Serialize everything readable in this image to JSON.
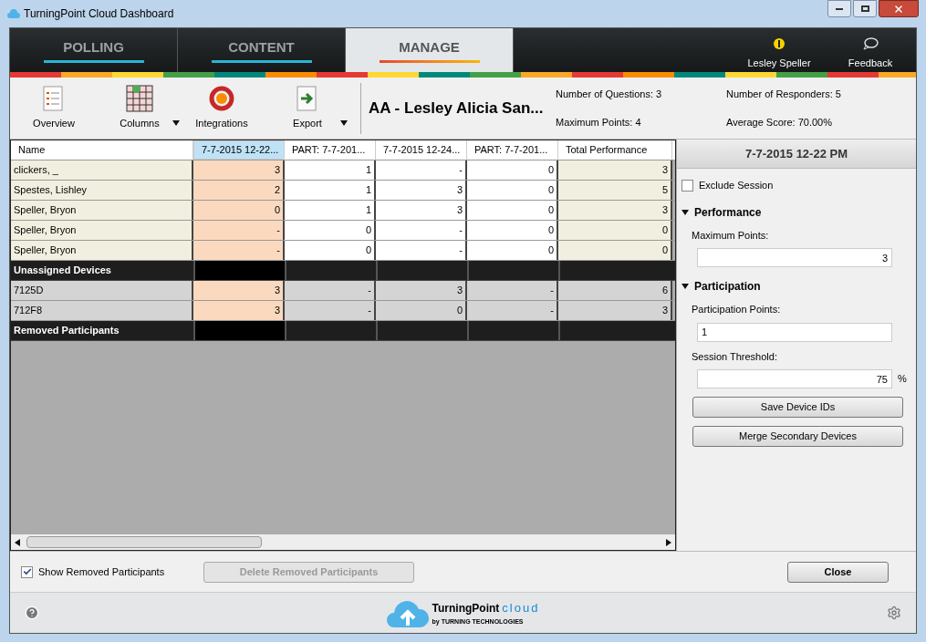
{
  "window": {
    "title": "TurningPoint Cloud Dashboard"
  },
  "nav_tabs": [
    {
      "label": "POLLING",
      "selected": false
    },
    {
      "label": "CONTENT",
      "selected": false
    },
    {
      "label": "MANAGE",
      "selected": true
    }
  ],
  "user": {
    "name": "Lesley Speller"
  },
  "feedback": {
    "label": "Feedback"
  },
  "toolbar": [
    {
      "label": "Overview",
      "kind": "overview",
      "dropdown": false
    },
    {
      "label": "Columns",
      "kind": "columns",
      "dropdown": true
    },
    {
      "label": "Integrations",
      "kind": "integrations",
      "dropdown": false
    },
    {
      "label": "Export",
      "kind": "export",
      "dropdown": true
    }
  ],
  "course_title": "AA - Lesley  Alicia San...",
  "stats": [
    {
      "label": "Number of Questions: 3"
    },
    {
      "label": "Number of Responders: 5"
    },
    {
      "label": "Maximum Points: 4"
    },
    {
      "label": "Average Score: 70.00%"
    }
  ],
  "table": {
    "columns": [
      {
        "label": "Name",
        "selected": false
      },
      {
        "label": "7-7-2015 12-22...",
        "selected": true
      },
      {
        "label": "PART: 7-7-201...",
        "selected": false
      },
      {
        "label": "7-7-2015 12-24...",
        "selected": false
      },
      {
        "label": "PART: 7-7-201...",
        "selected": false
      },
      {
        "label": "Total Performance",
        "selected": false
      }
    ],
    "rows": [
      {
        "kind": "participant",
        "cells": [
          "clickers, _",
          "3",
          "1",
          "-",
          "0",
          "3"
        ]
      },
      {
        "kind": "participant",
        "cells": [
          "Spestes, Lishley",
          "2",
          "1",
          "3",
          "0",
          "5"
        ]
      },
      {
        "kind": "participant",
        "cells": [
          "Speller, Bryon",
          "0",
          "1",
          "3",
          "0",
          "3"
        ]
      },
      {
        "kind": "participant",
        "cells": [
          "Speller, Bryon",
          "-",
          "0",
          "-",
          "0",
          "0"
        ]
      },
      {
        "kind": "participant",
        "cells": [
          "Speller, Bryon",
          "-",
          "0",
          "-",
          "0",
          "0"
        ]
      },
      {
        "kind": "group",
        "cells": [
          "Unassigned Devices"
        ]
      },
      {
        "kind": "device",
        "cells": [
          "7125D",
          "3",
          "-",
          "3",
          "-",
          "6"
        ]
      },
      {
        "kind": "device",
        "cells": [
          "712F8",
          "3",
          "-",
          "0",
          "-",
          "3"
        ]
      },
      {
        "kind": "group",
        "cells": [
          "Removed Participants"
        ]
      }
    ]
  },
  "session_panel": {
    "title": "7-7-2015 12-22 PM",
    "exclude_session": {
      "label": "Exclude Session",
      "checked": false
    },
    "sections": [
      {
        "title": "Performance",
        "expanded": true,
        "fields": [
          {
            "label": "Maximum Points:",
            "value": "3",
            "kind": "numeric"
          }
        ]
      },
      {
        "title": "Participation",
        "expanded": true,
        "fields": [
          {
            "label": "Participation Points:",
            "value": "1",
            "kind": "text"
          },
          {
            "label": "Session Threshold:",
            "value": "75",
            "kind": "numeric",
            "unit": "%"
          }
        ]
      }
    ],
    "buttons": [
      {
        "label": "Save Device IDs"
      },
      {
        "label": "Merge Secondary Devices"
      }
    ]
  },
  "bottom_bar": {
    "show_removed": {
      "label": "Show Removed Participants",
      "checked": true
    },
    "delete_button": {
      "label": "Delete Removed Participants",
      "disabled": true
    },
    "close_button": {
      "label": "Close"
    }
  },
  "footer": {
    "logo": {
      "brand": "TurningPoint",
      "product": "cloud",
      "byline": "by TURNING TECHNOLOGIES"
    }
  }
}
